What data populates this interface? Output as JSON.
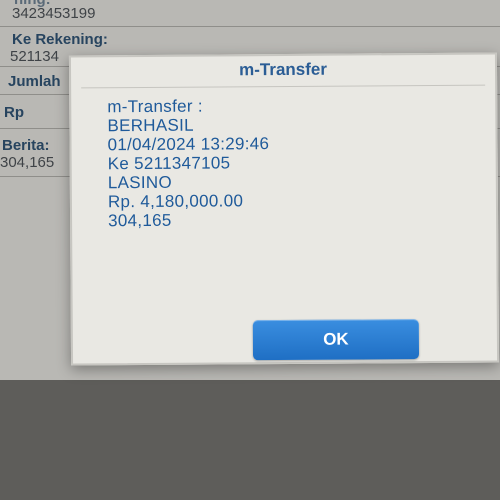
{
  "background_form": {
    "account_partial_label": "ning:",
    "account_value": "3423453199",
    "to_account_label": "Ke Rekening:",
    "to_account_value": "521134",
    "amount_label": "Jumlah",
    "currency_label": "Rp",
    "message_label": "Berita:",
    "message_value": "304,165"
  },
  "dialog": {
    "title": "m-Transfer",
    "lines": [
      "m-Transfer :",
      "BERHASIL",
      "01/04/2024 13:29:46",
      "Ke 5211347105",
      "LASINO",
      "Rp. 4,180,000.00",
      "304,165"
    ],
    "ok_label": "OK"
  },
  "colors": {
    "title": "#2b5d95",
    "body_text": "#1f5a9a",
    "ok_button": "#1f6fc4"
  }
}
